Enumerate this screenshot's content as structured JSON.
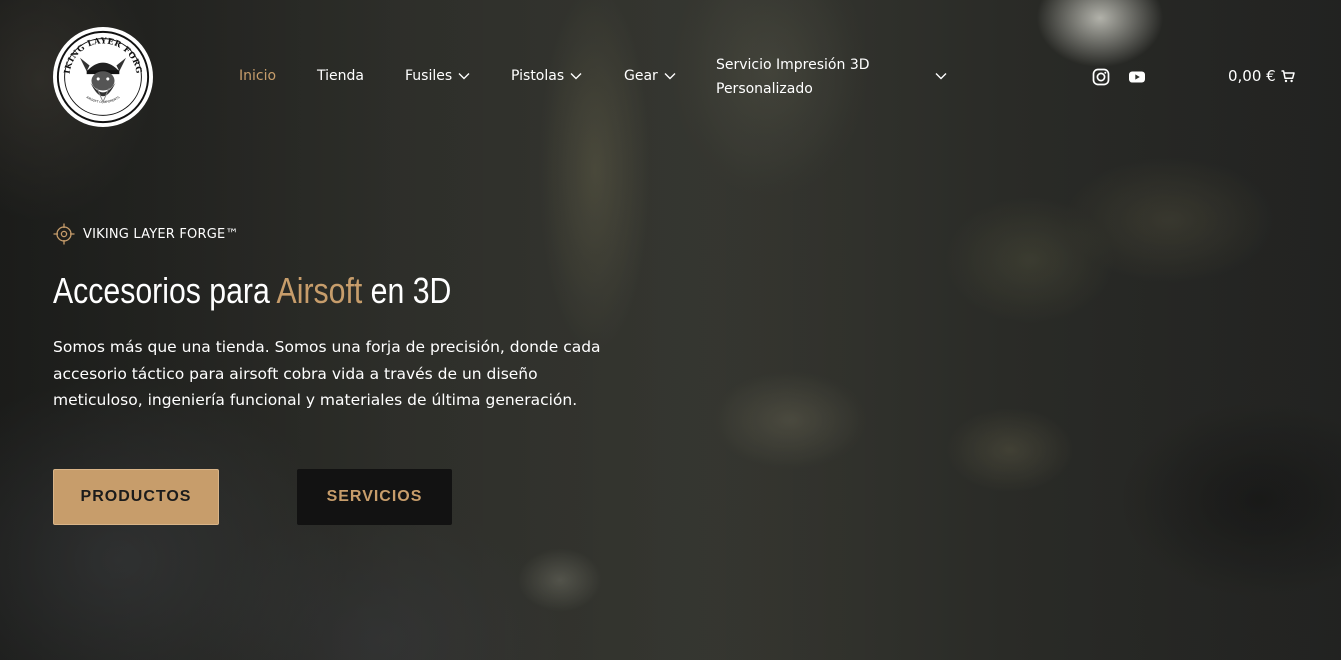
{
  "brand": {
    "logo_name": "VIKING LAYER FORGE",
    "logo_tagline": "AIRSOFT COMPONENTS"
  },
  "nav": {
    "items": [
      {
        "label": "Inicio",
        "active": true,
        "dropdown": false
      },
      {
        "label": "Tienda",
        "active": false,
        "dropdown": false
      },
      {
        "label": "Fusiles",
        "active": false,
        "dropdown": true
      },
      {
        "label": "Pistolas",
        "active": false,
        "dropdown": true
      },
      {
        "label": "Gear",
        "active": false,
        "dropdown": true
      }
    ],
    "service_line1": "Servicio Impresión 3D",
    "service_line2": "Personalizado"
  },
  "social": {
    "instagram": "instagram-icon",
    "youtube": "youtube-icon"
  },
  "cart": {
    "total": "0,00 €"
  },
  "hero": {
    "eyebrow": "VIKING LAYER FORGE™",
    "headline_pre": "Accesorios para ",
    "headline_accent": "Airsoft",
    "headline_post": " en 3D",
    "lead": "Somos más que una tienda. Somos una forja de precisión, donde cada accesorio táctico para airsoft cobra vida a través de un diseño meticuloso, ingeniería funcional y materiales de última generación.",
    "btn_products": "PRODUCTOS",
    "btn_services": "SERVICIOS"
  },
  "colors": {
    "accent": "#c79d6b",
    "dark_button": "#121212",
    "text": "#ffffff"
  }
}
